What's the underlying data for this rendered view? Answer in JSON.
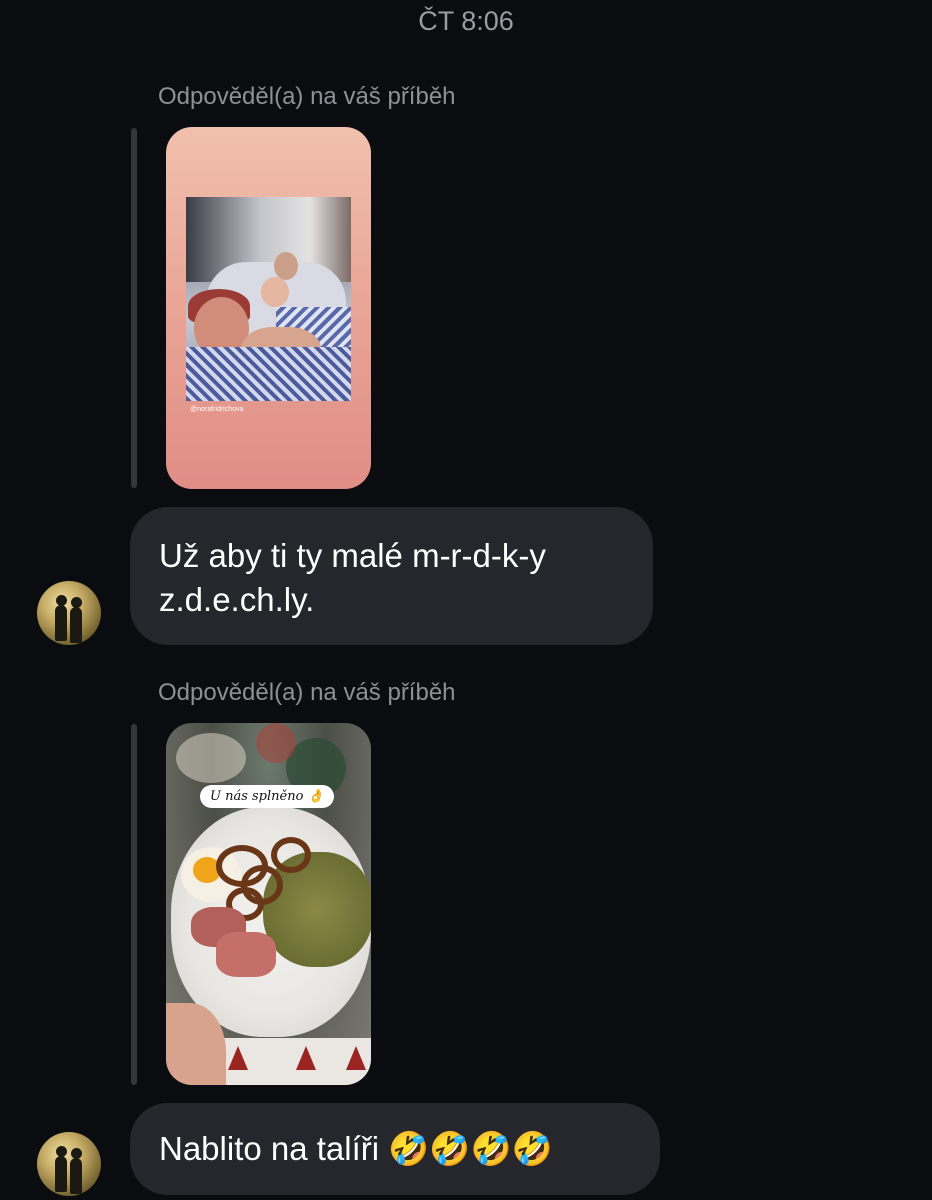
{
  "header": {
    "timestamp": "ČT 8:06"
  },
  "thread": {
    "items": [
      {
        "reply_label": "Odpověděl(a) na váš příběh",
        "story_credit": "@norafridrichova"
      },
      {
        "message": "Už aby ti ty malé m-r-d-k-y z.d.e.ch.ly."
      },
      {
        "reply_label": "Odpověděl(a) na váš příběh",
        "story_sticker": "U nás splněno 👌"
      },
      {
        "message": "Nablito na talíři 🤣🤣🤣🤣"
      }
    ]
  },
  "colors": {
    "background": "#0b0c10",
    "bubble": "#25272c",
    "muted_text": "#8e9096"
  },
  "icons": {
    "avatar": "avatar-silhouette-couple"
  }
}
